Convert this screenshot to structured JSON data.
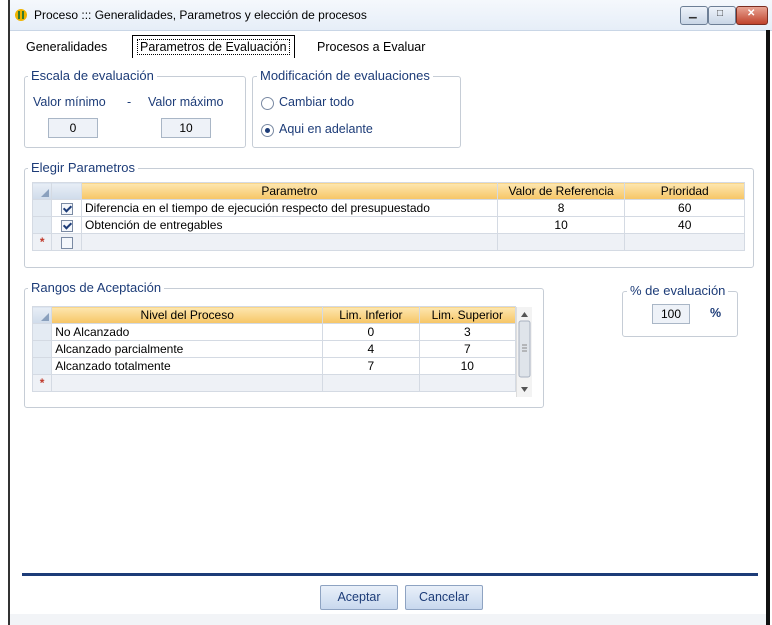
{
  "window": {
    "title": "Proceso ::: Generalidades, Parametros y elección de procesos",
    "minimize_glyph": "▁",
    "maximize_glyph": "□",
    "close_glyph": "✕"
  },
  "tabs": [
    {
      "label": "Generalidades",
      "active": false
    },
    {
      "label": "Parametros de Evaluación",
      "active": true
    },
    {
      "label": "Procesos a Evaluar",
      "active": false
    }
  ],
  "escala": {
    "legend": "Escala de evaluación",
    "min_label": "Valor mínimo",
    "dash": "-",
    "max_label": "Valor máximo",
    "min_value": "0",
    "max_value": "10"
  },
  "modificacion": {
    "legend": "Modificación de evaluaciones",
    "options": [
      {
        "label": "Cambiar todo",
        "selected": false
      },
      {
        "label": "Aqui en adelante",
        "selected": true
      }
    ]
  },
  "parametros": {
    "legend": "Elegir Parametros",
    "columns": [
      "Parametro",
      "Valor de Referencia",
      "Prioridad"
    ],
    "rows": [
      {
        "checked": true,
        "parametro": "Diferencia en el tiempo de ejecución respecto del presupuestado",
        "valor": "8",
        "prioridad": "60"
      },
      {
        "checked": true,
        "parametro": "Obtención de entregables",
        "valor": "10",
        "prioridad": "40"
      }
    ],
    "new_row_marker": "*"
  },
  "rangos": {
    "legend": "Rangos de Aceptación",
    "columns": [
      "Nivel del Proceso",
      "Lim. Inferior",
      "Lim. Superior"
    ],
    "rows": [
      {
        "nivel": "No Alcanzado",
        "inf": "0",
        "sup": "3"
      },
      {
        "nivel": "Alcanzado parcialmente",
        "inf": "4",
        "sup": "7"
      },
      {
        "nivel": "Alcanzado totalmente",
        "inf": "7",
        "sup": "10"
      }
    ],
    "new_row_marker": "*"
  },
  "porcentaje": {
    "legend": "% de evaluación",
    "value": "100",
    "unit": "%"
  },
  "buttons": {
    "accept": "Aceptar",
    "cancel": "Cancelar"
  },
  "colors": {
    "accent": "#1d3c78",
    "header": "#f6c565"
  }
}
